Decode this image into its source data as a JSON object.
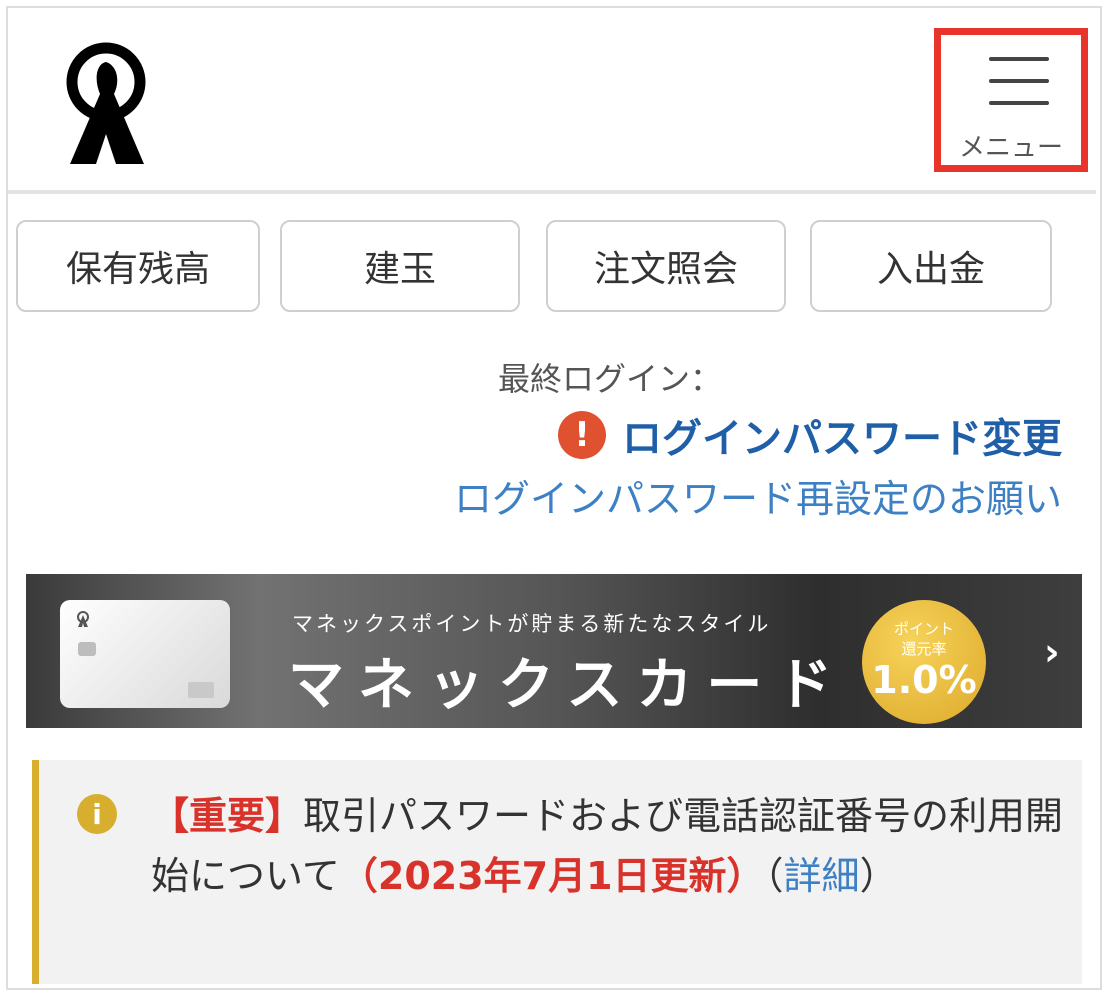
{
  "header": {
    "logo": "monex-logo",
    "menu_label": "メニュー",
    "menu_icon": "hamburger-icon",
    "highlight_color": "#e8342a"
  },
  "quick_links": [
    {
      "label": "保有残高"
    },
    {
      "label": "建玉"
    },
    {
      "label": "注文照会"
    },
    {
      "label": "入出金"
    }
  ],
  "account": {
    "last_login_label": "最終ログイン：",
    "alert_icon": "exclamation-icon",
    "password_change": "ログインパスワード変更",
    "password_reset": "ログインパスワード再設定のお願い"
  },
  "banner": {
    "subtitle": "マネックスポイントが貯まる新たなスタイル",
    "title": "マネックスカード",
    "badge_line1": "ポイント",
    "badge_line2": "還元率",
    "badge_rate": "1.0%",
    "arrow": "›"
  },
  "notice": {
    "icon": "info-icon",
    "tag": "【重要】",
    "text": "取引パスワードおよび電話認証番号の利用開始について",
    "date": "（2023年7月1日更新）",
    "open": "（",
    "link": "詳細",
    "close": "）",
    "accent_color": "#d7ae2e"
  }
}
